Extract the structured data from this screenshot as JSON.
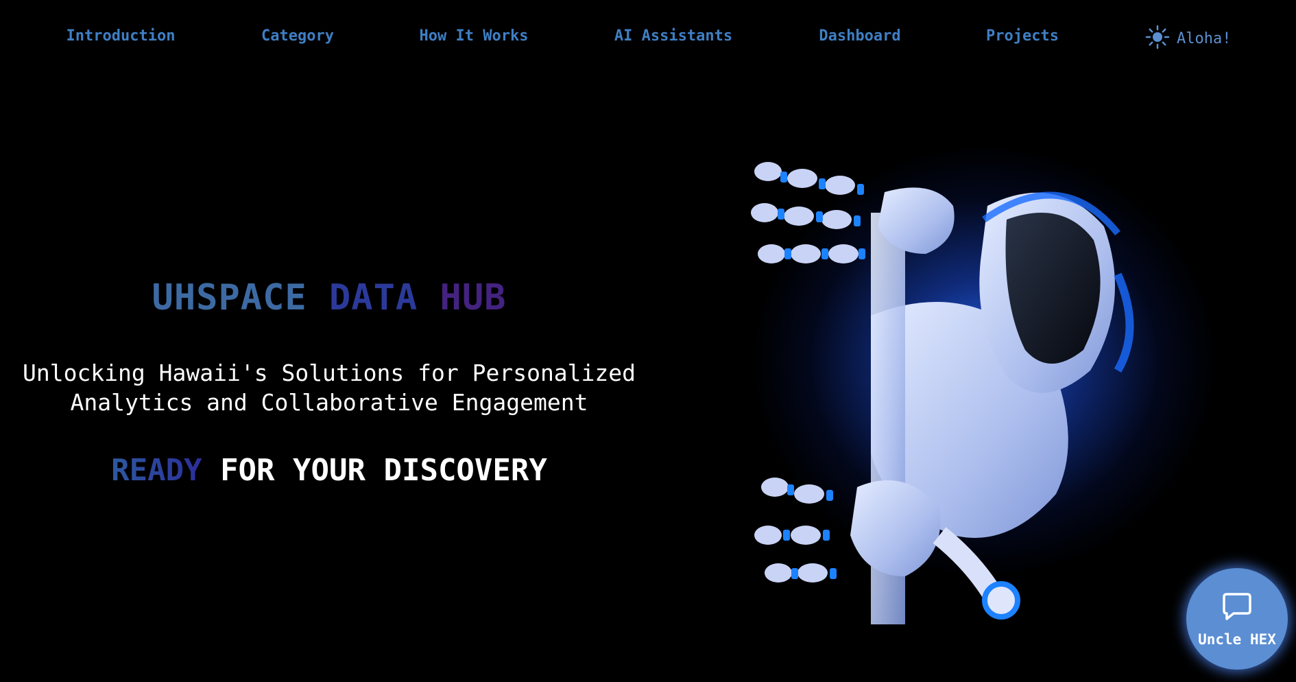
{
  "nav": {
    "items": [
      {
        "label": "Introduction"
      },
      {
        "label": "Category"
      },
      {
        "label": "How It Works"
      },
      {
        "label": "AI Assistants"
      },
      {
        "label": "Dashboard"
      },
      {
        "label": "Projects"
      }
    ],
    "greeting": "Aloha!",
    "greeting_icon": "sun-icon"
  },
  "hero": {
    "title_part1": "UHSPACE",
    "title_part2": "DATA",
    "title_part3": "HUB",
    "subtitle_line1": "Unlocking Hawaii's Solutions for Personalized",
    "subtitle_line2": "Analytics and Collaborative Engagement",
    "cta_highlight": "READY",
    "cta_rest": "FOR YOUR DISCOVERY"
  },
  "chat": {
    "label": "Uncle HEX",
    "icon": "chat-bubble-icon"
  },
  "colors": {
    "background": "#000000",
    "nav_text": "#3f7fc4",
    "accent_blue": "#2669ff",
    "chat_button": "#5b8ed3"
  }
}
